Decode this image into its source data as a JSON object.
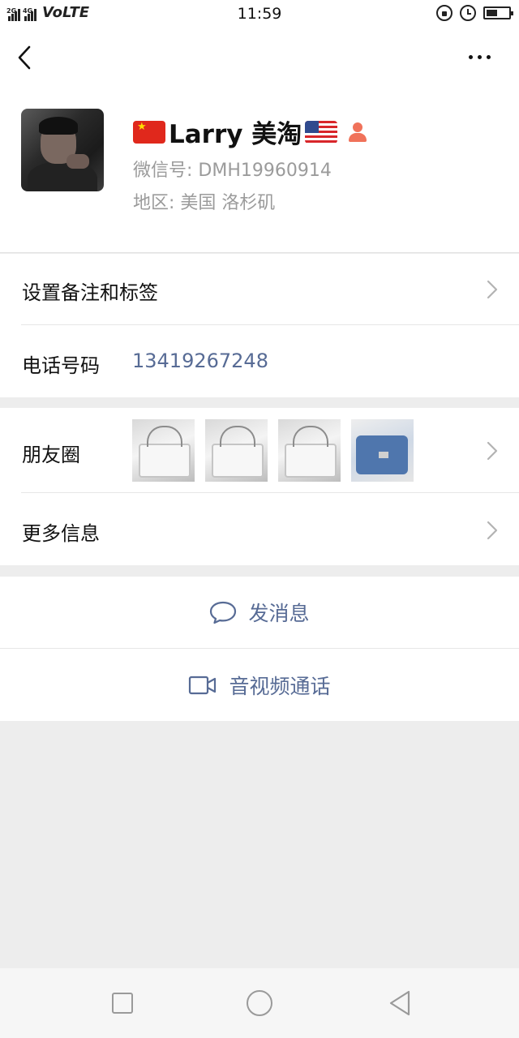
{
  "status_bar": {
    "time": "11:59",
    "network_label": "VoLTE",
    "sim1_tag": "2G",
    "sim2_tag": "4G",
    "battery_percent": 40
  },
  "navbar": {
    "back_icon": "chevron-left-icon",
    "more_icon": "more-dots-icon"
  },
  "profile": {
    "flag_left": "china-flag-icon",
    "nickname": "Larry 美淘",
    "flag_right": "usa-flag-icon",
    "badge_icon": "person-icon",
    "wechat_id": "微信号: DMH19960914",
    "region": "地区: 美国  洛杉矶"
  },
  "rows": {
    "remark_label": "设置备注和标签",
    "phone_label": "电话号码",
    "phone_value": "13419267248",
    "moments_label": "朋友圈",
    "more_info_label": "更多信息"
  },
  "actions": {
    "message_label": "发消息",
    "call_label": "音视频通话"
  },
  "colors": {
    "link": "#576b95",
    "background": "#ededed",
    "card": "#ffffff"
  }
}
